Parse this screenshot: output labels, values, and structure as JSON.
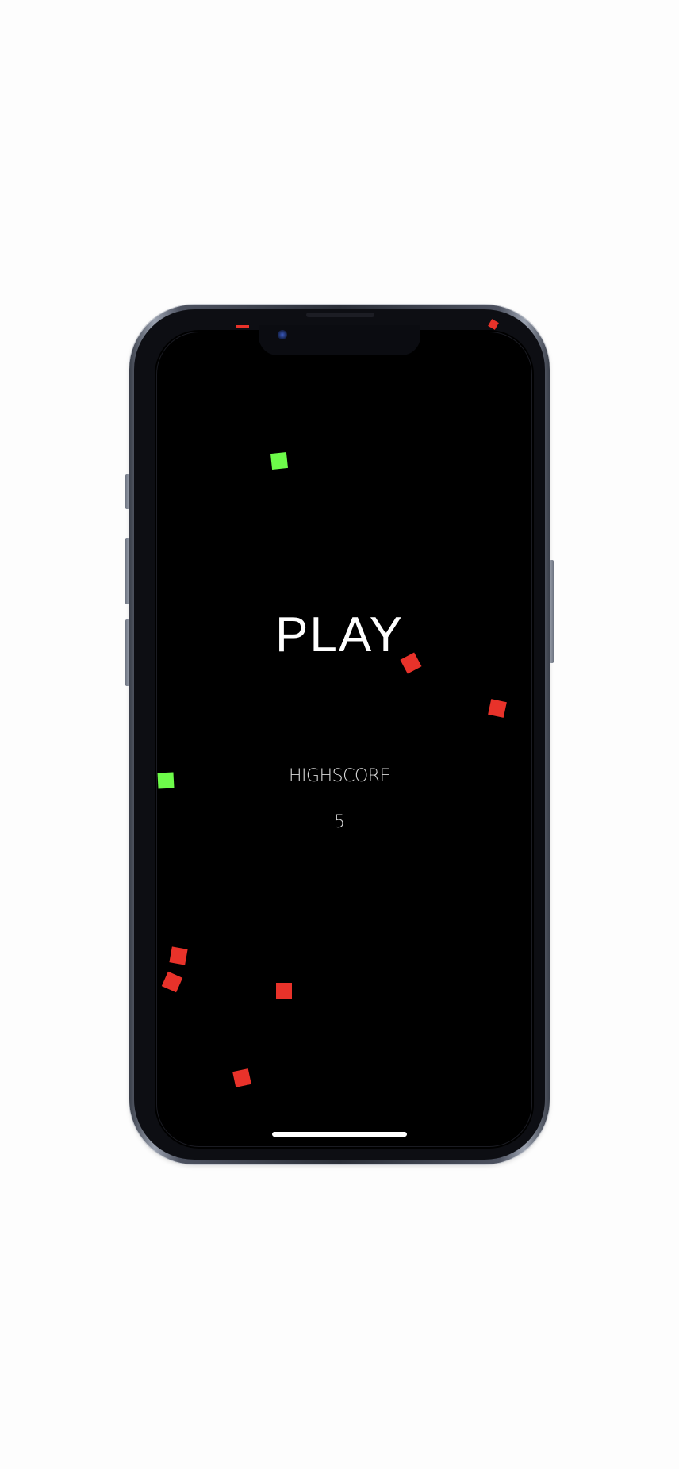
{
  "game": {
    "play_label": "PLAY",
    "highscore_label": "HIGHSCORE",
    "highscore_value": "5"
  },
  "colors": {
    "background": "#000000",
    "good_block": "#6dfb4a",
    "bad_block": "#e8322a",
    "text": "#ffffff"
  }
}
